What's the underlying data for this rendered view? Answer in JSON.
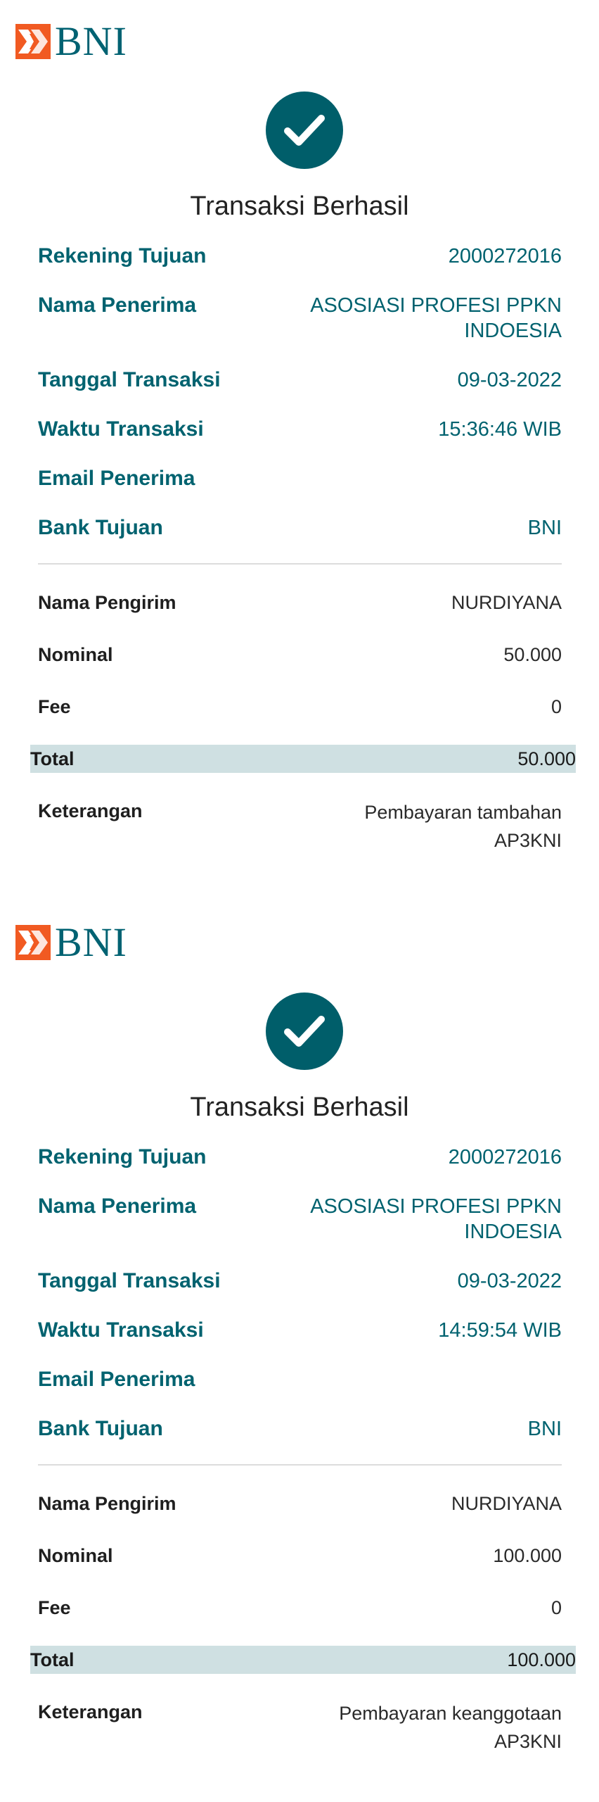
{
  "receipts": [
    {
      "bank_logo": "BNI",
      "status_title": "Transaksi Berhasil",
      "fields": {
        "rekening_tujuan": {
          "label": "Rekening Tujuan",
          "value": "2000272016"
        },
        "nama_penerima": {
          "label": "Nama Penerima",
          "value": "ASOSIASI PROFESI PPKN INDOESIA"
        },
        "tanggal_transaksi": {
          "label": "Tanggal Transaksi",
          "value": "09-03-2022"
        },
        "waktu_transaksi": {
          "label": "Waktu Transaksi",
          "value": "15:36:46 WIB"
        },
        "email_penerima": {
          "label": "Email Penerima",
          "value": ""
        },
        "bank_tujuan": {
          "label": "Bank Tujuan",
          "value": "BNI"
        },
        "nama_pengirim": {
          "label": "Nama Pengirim",
          "value": "NURDIYANA"
        },
        "nominal": {
          "label": "Nominal",
          "value": "50.000"
        },
        "fee": {
          "label": "Fee",
          "value": "0"
        },
        "total": {
          "label": "Total",
          "value": "50.000"
        },
        "keterangan": {
          "label": "Keterangan",
          "value": "Pembayaran tambahan AP3KNI"
        }
      }
    },
    {
      "bank_logo": "BNI",
      "status_title": "Transaksi Berhasil",
      "fields": {
        "rekening_tujuan": {
          "label": "Rekening Tujuan",
          "value": "2000272016"
        },
        "nama_penerima": {
          "label": "Nama Penerima",
          "value": "ASOSIASI PROFESI PPKN INDOESIA"
        },
        "tanggal_transaksi": {
          "label": "Tanggal Transaksi",
          "value": "09-03-2022"
        },
        "waktu_transaksi": {
          "label": "Waktu Transaksi",
          "value": "14:59:54 WIB"
        },
        "email_penerima": {
          "label": "Email Penerima",
          "value": ""
        },
        "bank_tujuan": {
          "label": "Bank Tujuan",
          "value": "BNI"
        },
        "nama_pengirim": {
          "label": "Nama Pengirim",
          "value": "NURDIYANA"
        },
        "nominal": {
          "label": "Nominal",
          "value": "100.000"
        },
        "fee": {
          "label": "Fee",
          "value": "0"
        },
        "total": {
          "label": "Total",
          "value": "100.000"
        },
        "keterangan": {
          "label": "Keterangan",
          "value": "Pembayaran keanggotaan AP3KNI"
        }
      }
    }
  ],
  "icons": {
    "logo_mark": "bni-logo-mark-icon",
    "status": "checkmark-icon"
  },
  "colors": {
    "brand_teal": "#005e6a",
    "brand_orange": "#f15a22",
    "total_highlight": "#cfe0e2"
  }
}
